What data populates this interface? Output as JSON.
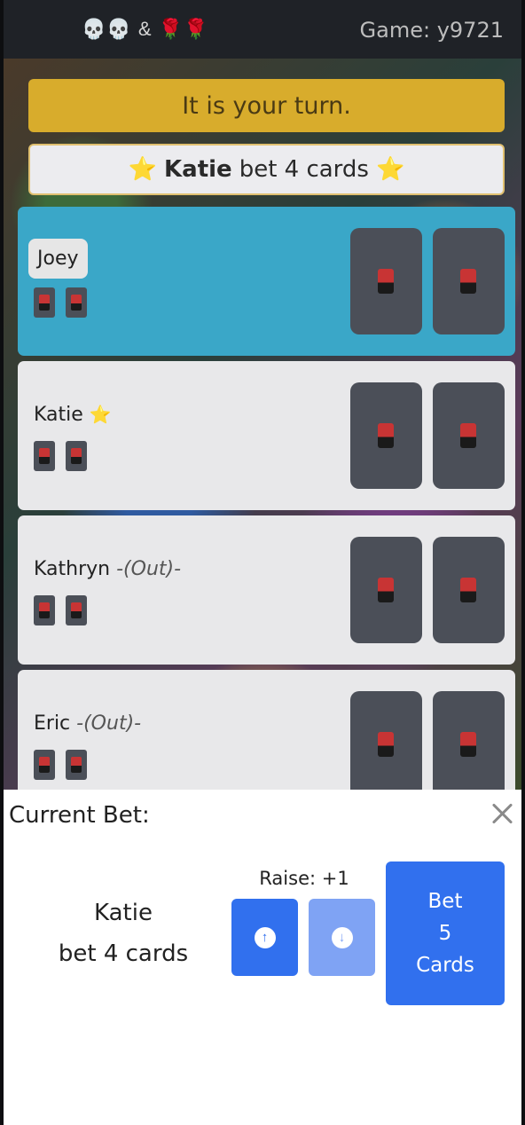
{
  "header": {
    "brand": "💀💀 & 🌹🌹",
    "game_code": "Game: y9721"
  },
  "status": {
    "turn_message": "It is your turn.",
    "bet_leader": "Katie",
    "bet_text": "bet 4 cards",
    "star_icon": "⭐"
  },
  "players": [
    {
      "name": "Joey",
      "status": "",
      "active": true
    },
    {
      "name": "Katie",
      "status": "",
      "starred": true
    },
    {
      "name": "Kathryn",
      "status": "-(Out)-"
    },
    {
      "name": "Eric",
      "status": "-(Out)-"
    }
  ],
  "panel": {
    "title": "Current Bet:",
    "current_bidder": "Katie",
    "current_bet": "bet 4 cards",
    "raise_label": "Raise: +1",
    "up_icon": "↑",
    "down_icon": "↓",
    "bet_button": [
      "Bet",
      "5",
      "Cards"
    ]
  },
  "colors": {
    "accent": "#3170ee",
    "turn_banner": "#d8ac2c",
    "active_player": "#3aa7c8"
  }
}
